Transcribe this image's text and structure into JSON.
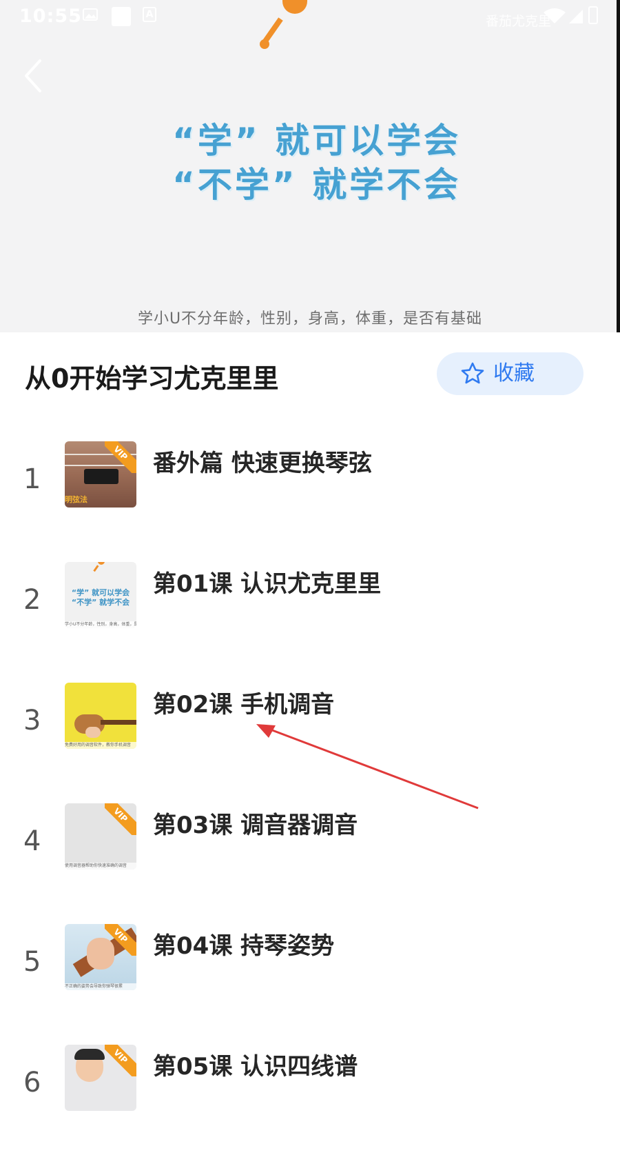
{
  "status_bar": {
    "time": "10:55",
    "carrier": "番茄尤克里",
    "icons": [
      "image-icon",
      "square-icon",
      "font-a-icon",
      "wifi-icon",
      "signal-icon",
      "battery-icon"
    ]
  },
  "hero": {
    "slogan_line1": "“学” 就可以学会",
    "slogan_line2": "“不学” 就学不会",
    "caption": "学小U不分年龄，性别，身高，体重，是否有基础",
    "back_icon": "chevron-left-icon"
  },
  "course": {
    "title": "从0开始学习尤克里里",
    "favorite_label": "收藏",
    "favorite_icon": "star-outline-icon"
  },
  "vip_label": "VIP",
  "lessons": [
    {
      "num": "1",
      "title": "番外篇 快速更换琴弦",
      "vip": true,
      "thumb_tag": "明弦法"
    },
    {
      "num": "2",
      "title": "第01课 认识尤克里里",
      "vip": false,
      "thumb_text_1": "“学” 就可以学会",
      "thumb_text_2": "“不学” 就学不会",
      "thumb_sub": "学小U不分年龄，性别，身高，体重，是否有基础"
    },
    {
      "num": "3",
      "title": "第02课 手机调音",
      "vip": false,
      "thumb_sub": "免费好用的调音软件，教你手机调音"
    },
    {
      "num": "4",
      "title": "第03课 调音器调音",
      "vip": true,
      "thumb_sub": "使用调音器帮助你快速准确的调音"
    },
    {
      "num": "5",
      "title": "第04课 持琴姿势",
      "vip": true,
      "thumb_sub": "不正确的姿势会导致你弹琴很累"
    },
    {
      "num": "6",
      "title": "第05课 认识四线谱",
      "vip": true
    }
  ],
  "colors": {
    "accent_blue": "#2f7af0",
    "favorite_bg": "#e6f0fd",
    "slogan_blue": "#46a1d2",
    "vip_orange": "#f39c1f",
    "annotation_red": "#e03a3a"
  }
}
